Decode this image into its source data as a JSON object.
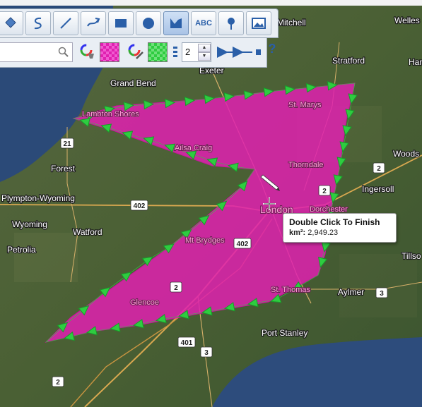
{
  "map": {
    "labels": {
      "mitchell": "Mitchell",
      "wellesley": "Welles",
      "stratford": "Stratford",
      "ham": "Ham",
      "exeter": "Exeter",
      "grand_bend": "Grand Bend",
      "lambton_shores": "Lambton Shores",
      "st_marys": "St. Marys",
      "ailsa_craig": "Ailsa Craig",
      "thorndale": "Thorndale",
      "woods": "Woods",
      "forest": "Forest",
      "ingersoll": "Ingersoll",
      "plympton": "Plympton-Wyoming",
      "london": "London",
      "dorchester": "Dorchester",
      "wyoming": "Wyoming",
      "watford": "Watford",
      "mt_brydges": "Mt Brydges",
      "petrolia": "Petrolia",
      "tillson": "Tillso",
      "glencoe": "Glencoe",
      "st_thomas": "St. Thomas",
      "aylmer": "Aylmer",
      "port_stanley": "Port Stanley"
    },
    "shields": {
      "hwy21": "21",
      "hwy402_west": "402",
      "hwy402_london": "402",
      "hwy2_east": "2",
      "hwy2_london": "2",
      "hwy2_south": "2",
      "hwy2_sw": "2",
      "hwy401": "401",
      "hwy3_south": "3",
      "hwy3_aylmer": "3"
    },
    "polygon_fill": "#e020b0",
    "arrow_color": "#2ecc40"
  },
  "toolbar": {
    "tools": [
      "fill-tool",
      "freehand-tool",
      "line-tool",
      "route-tool",
      "rectangle-tool",
      "circle-tool",
      "polygon-tool",
      "text-tool",
      "marker-tool",
      "image-tool"
    ],
    "text_tool_label": "ABC",
    "line_width": "2",
    "help_label": "?"
  },
  "tooltip": {
    "title": "Double Click To Finish",
    "area_label": "km²:",
    "area_value": " 2,949.23"
  }
}
